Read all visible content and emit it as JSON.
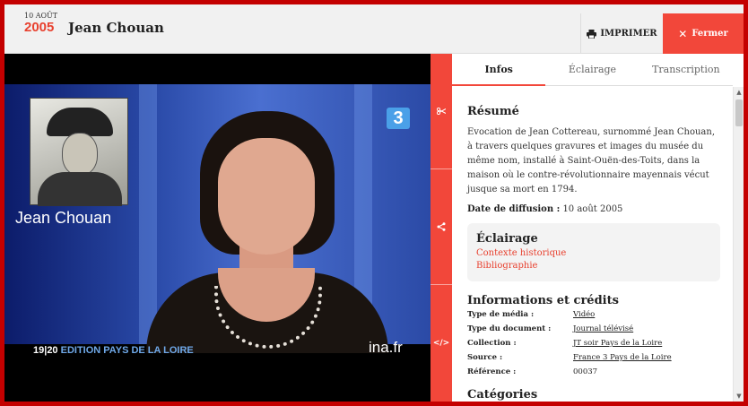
{
  "header": {
    "date_day": "10 AOÛT",
    "date_year": "2005",
    "title": "Jean Chouan",
    "print_label": "IMPRIMER",
    "close_label": "Fermer"
  },
  "video": {
    "caption_name": "Jean Chouan",
    "channel_logo": "3",
    "edition_prefix": "19|20",
    "edition_rest": " EDITION PAYS DE LA LOIRE",
    "watermark": "ina.fr"
  },
  "actions": {
    "cut_icon": "scissors-icon",
    "share_icon": "share-icon",
    "embed_icon": "embed-icon"
  },
  "tabs": [
    {
      "label": "Infos",
      "active": true
    },
    {
      "label": "Éclairage",
      "active": false
    },
    {
      "label": "Transcription",
      "active": false
    }
  ],
  "infos": {
    "summary_title": "Résumé",
    "summary_text": "Evocation de Jean Cottereau, surnommé Jean Chouan, à travers quelques gravures et images du musée du même nom, installé à Saint-Ouën-des-Toits, dans la maison où le contre-révolutionnaire mayennais vécut jusque sa mort en 1794.",
    "diffusion_label": "Date de diffusion :",
    "diffusion_value": " 10 août 2005",
    "eclairage_title": "Éclairage",
    "eclairage_links": [
      "Contexte historique",
      "Bibliographie"
    ],
    "credits_title": "Informations et crédits",
    "credits": [
      {
        "key": "Type de média :",
        "value": "Vidéo"
      },
      {
        "key": "Type du document :",
        "value": "Journal télévisé"
      },
      {
        "key": "Collection :",
        "value": "JT soir Pays de la Loire"
      },
      {
        "key": "Source :",
        "value": "France 3 Pays de la Loire"
      },
      {
        "key": "Référence :",
        "value": "00037"
      }
    ],
    "categories_title": "Catégories"
  },
  "colors": {
    "accent": "#f2473a",
    "outer_frame": "#c40000"
  }
}
